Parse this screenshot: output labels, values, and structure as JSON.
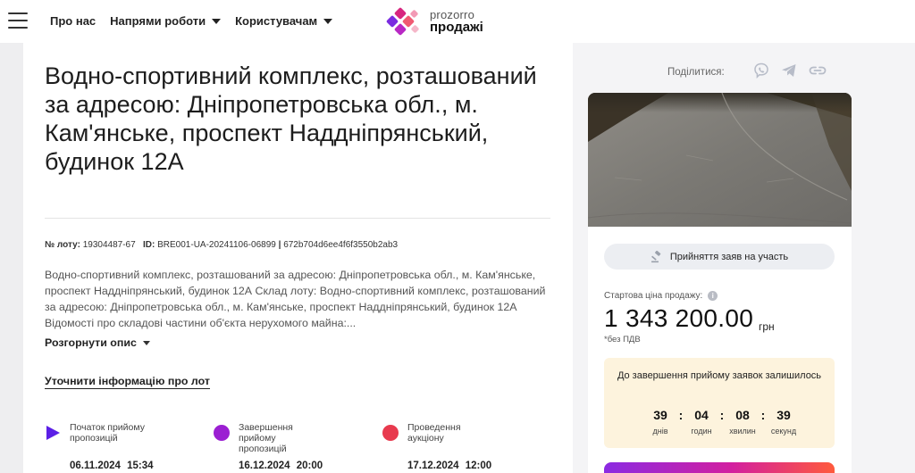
{
  "header": {
    "nav": [
      {
        "label": "Про нас",
        "dropdown": false
      },
      {
        "label": "Напрями роботи",
        "dropdown": true
      },
      {
        "label": "Користувачам",
        "dropdown": true
      }
    ],
    "logo": {
      "line1": "prozorro",
      "line2": "продажі"
    }
  },
  "lot": {
    "title": "Водно-спортивний комплекс, розташований за адресою: Дніпропетровська обл., м. Кам'янське, проспект Наддніпрянський, будинок 12А",
    "lot_number_label": "№ лоту:",
    "lot_number": "19304487-67",
    "id_label": "ID:",
    "id": "BRE001-UA-20241106-06899",
    "separator": "|",
    "hash": "672b704d6ee4f6f3550b2ab3",
    "description": "Водно-спортивний комплекс, розташований за адресою: Дніпропетровська обл., м. Кам'янське, проспект Наддніпрянський, будинок 12А Склад лоту: Водно-спортивний комплекс, розташований за адресою: Дніпропетровська обл., м. Кам'янське, проспект Наддніпрянський, будинок 12А Відомості про складові частини об'єкта нерухомого майна:...",
    "expand_label": "Розгорнути опис",
    "clarify_label": "Уточнити інформацію про лот"
  },
  "timeline": [
    {
      "label": "Початок прийому пропозицій",
      "date": "06.11.2024",
      "time": "15:34",
      "color": "#5b1fe6",
      "icon": "play-icon"
    },
    {
      "label": "Завершення прийому пропозицій",
      "date": "16.12.2024",
      "time": "20:00",
      "color": "#9b1fd2",
      "icon": "purple-dot-icon"
    },
    {
      "label": "Проведення аукціону",
      "date": "17.12.2024",
      "time": "12:00",
      "color": "#e83a4e",
      "icon": "red-dot-icon"
    }
  ],
  "share": {
    "label": "Поділитися:",
    "icons": [
      "viber-icon",
      "telegram-icon",
      "link-icon"
    ]
  },
  "sidebar": {
    "accept_button": "Прийняття заяв на участь",
    "price_label": "Стартова ціна продажу:",
    "price": "1 343 200.00",
    "currency": "грн",
    "vat_note": "*без ПДВ",
    "countdown": {
      "title": "До завершення прийому заявок залишилось",
      "days": "39",
      "days_label": "днів",
      "hours": "04",
      "hours_label": "годин",
      "minutes": "08",
      "minutes_label": "хвилин",
      "seconds": "39",
      "seconds_label": "секунд"
    }
  },
  "colors": {
    "accent_gradient": [
      "#8b2be2",
      "#d21fa0",
      "#ff5a3c"
    ],
    "countdown_bg": "#fdf3dd"
  }
}
